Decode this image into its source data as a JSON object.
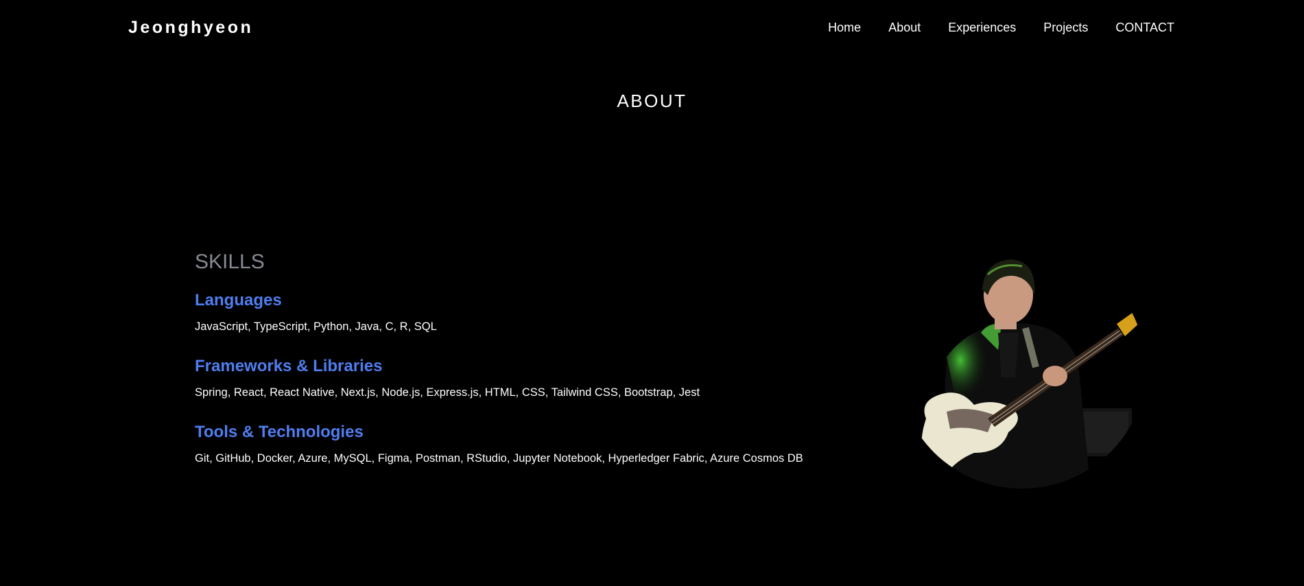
{
  "header": {
    "brand": "Jeonghyeon",
    "nav": [
      {
        "label": "Home"
      },
      {
        "label": "About"
      },
      {
        "label": "Experiences"
      },
      {
        "label": "Projects"
      },
      {
        "label": "CONTACT"
      }
    ]
  },
  "about": {
    "title": "ABOUT",
    "skills": {
      "heading": "SKILLS",
      "groups": [
        {
          "title": "Languages",
          "items": "JavaScript, TypeScript, Python, Java, C, R, SQL"
        },
        {
          "title": "Frameworks & Libraries",
          "items": "Spring, React, React Native, Next.js, Node.js, Express.js, HTML, CSS, Tailwind CSS, Bootstrap, Jest"
        },
        {
          "title": "Tools & Technologies",
          "items": "Git, GitHub, Docker, Azure, MySQL, Figma, Postman, RStudio, Jupyter Notebook, Hyperledger Fabric, Azure Cosmos DB"
        }
      ]
    },
    "photo": {
      "icon": "profile-photo-bassist"
    }
  },
  "colors": {
    "background": "#000000",
    "text": "#ffffff",
    "skills_heading": "#878a92",
    "accent": "#4f7ef0",
    "photo_highlight": "#4cd33a"
  }
}
